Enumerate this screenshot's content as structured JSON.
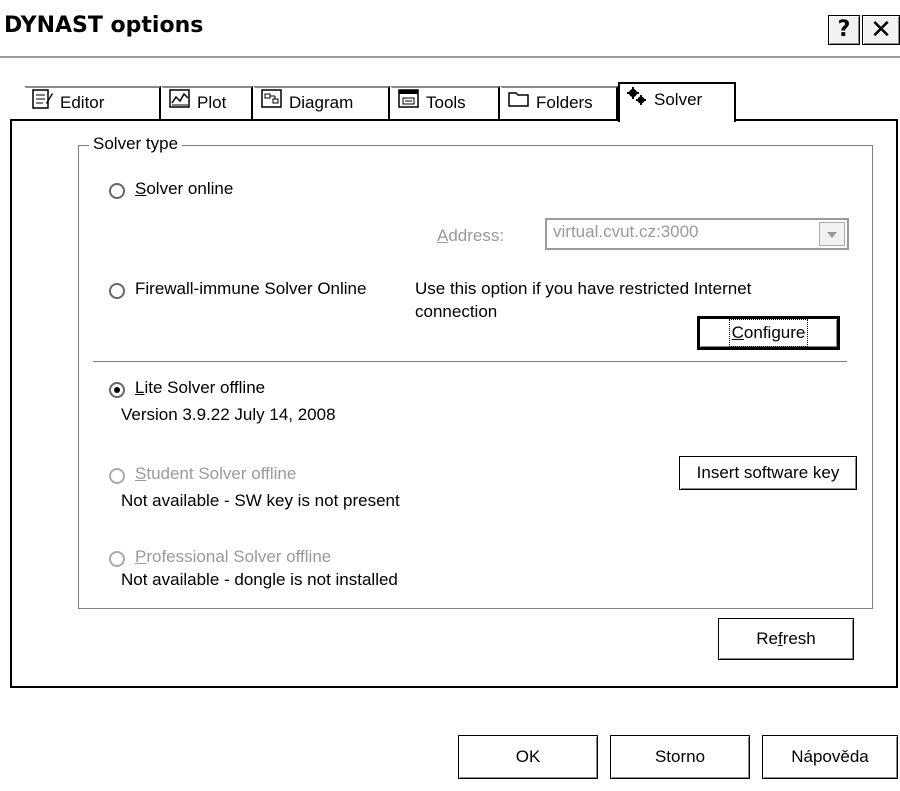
{
  "window": {
    "title": "DYNAST options",
    "help_button": "?",
    "close_button": "✕"
  },
  "tabs": [
    {
      "label": "Editor",
      "icon": "editor-icon"
    },
    {
      "label": "Plot",
      "icon": "plot-icon"
    },
    {
      "label": "Diagram",
      "icon": "diagram-icon"
    },
    {
      "label": "Tools",
      "icon": "tools-icon"
    },
    {
      "label": "Folders",
      "icon": "folder-icon"
    },
    {
      "label": "Solver",
      "icon": "gears-icon",
      "active": true
    }
  ],
  "solver_type": {
    "legend": "Solver type",
    "online": {
      "label": "Solver online",
      "mnemonic": "S",
      "label_rest": "olver online",
      "checked": false
    },
    "address": {
      "label_mnemonic": "A",
      "label_rest": "ddress:",
      "value": "virtual.cvut.cz:3000"
    },
    "firewall": {
      "label": "Firewall-immune Solver Online",
      "checked": false
    },
    "firewall_note": {
      "line1": "Use this option if you have restricted Internet",
      "line2": "connection"
    },
    "configure_button": {
      "mnemonic": "C",
      "rest": "onfigure"
    },
    "lite": {
      "mnemonic": "L",
      "label_rest": "ite Solver offline",
      "checked": true,
      "version": "Version 3.9.22 July 14, 2008"
    },
    "student": {
      "mnemonic": "S",
      "label_rest": "tudent Solver offline",
      "enabled": false,
      "status": "Not available - SW key is not present"
    },
    "insert_key_button": "Insert software key",
    "professional": {
      "mnemonic": "P",
      "label_rest": "rofessional Solver offline",
      "enabled": false,
      "status": "Not available - dongle is not installed"
    }
  },
  "refresh_button": {
    "pre": "Re",
    "mnemonic": "f",
    "rest": "resh"
  },
  "footer": {
    "ok": "OK",
    "cancel": "Storno",
    "help": "Nápověda"
  }
}
